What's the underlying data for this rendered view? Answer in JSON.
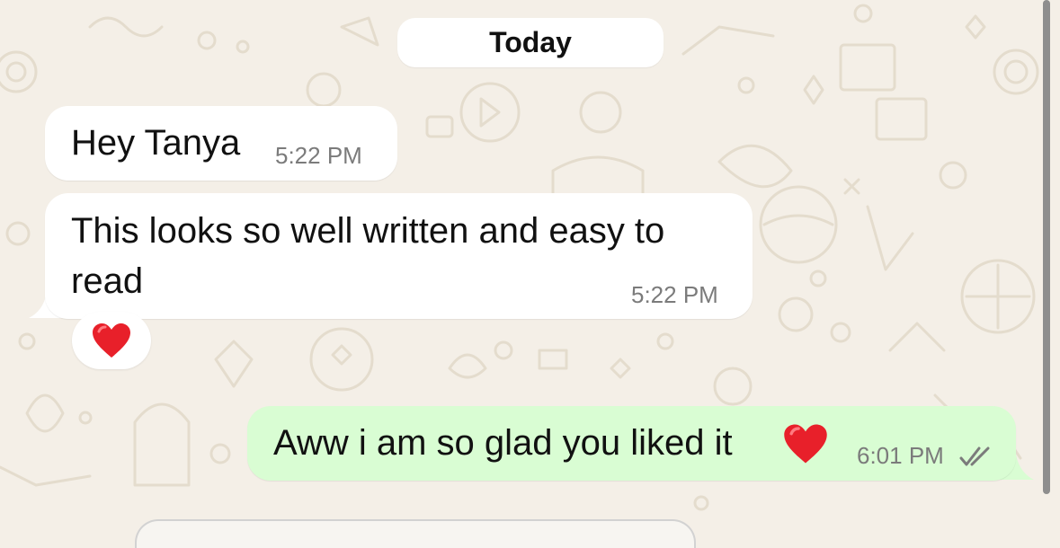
{
  "chat": {
    "date_label": "Today",
    "messages": [
      {
        "direction": "incoming",
        "text": "Hey Tanya",
        "time": "5:22 PM"
      },
      {
        "direction": "incoming",
        "text_line_1": "This looks so well written and easy to",
        "text_line_2": "read",
        "time": "5:22 PM",
        "reaction": "heart-emoji"
      },
      {
        "direction": "outgoing",
        "text": "Aww i am so glad you liked it",
        "emoji": "heart-emoji",
        "time": "6:01 PM",
        "status": "double-check-icon"
      }
    ]
  },
  "colors": {
    "wallpaper": "#f4efe7",
    "incoming_bubble": "#ffffff",
    "outgoing_bubble": "#d9fdd3",
    "timestamp": "#7b7b7b",
    "heart": "#e8202a"
  }
}
